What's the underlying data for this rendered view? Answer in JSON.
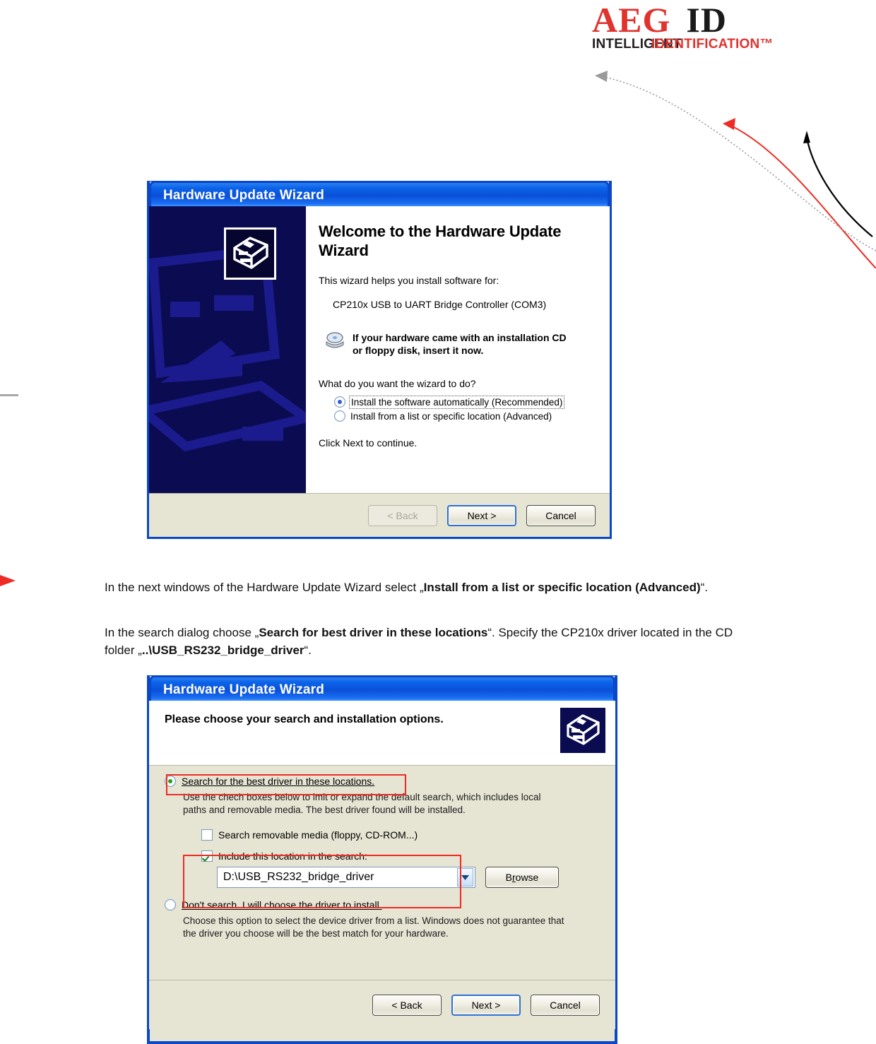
{
  "logo": {
    "primary": "AEG",
    "secondary": "ID",
    "tagline_black": "INTELLIGENT",
    "tagline_red": "IDENTIFICATION™",
    "red": "#e0332e",
    "black": "#1a1a1a"
  },
  "dialog1": {
    "title": "Hardware Update Wizard",
    "heading": "Welcome to the Hardware Update Wizard",
    "intro": "This wizard helps you install software for:",
    "device": "CP210x USB to UART Bridge Controller (COM3)",
    "cd_note_line1": "If your hardware came with an installation CD",
    "cd_note_line2": "or floppy disk, insert it now.",
    "question": "What do you want the wizard to do?",
    "options": [
      {
        "label": "Install the software automatically (Recommended)",
        "selected": true
      },
      {
        "label": "Install from a list or specific location (Advanced)",
        "selected": false
      }
    ],
    "footer_note": "Click Next to continue.",
    "buttons": {
      "back": "< Back",
      "next": "Next >",
      "cancel": "Cancel"
    }
  },
  "body_text": {
    "p1_a": "In the next windows of the Hardware Update Wizard select „",
    "p1_bold": "Install from a list or specific location (Advanced)",
    "p1_b": "“.",
    "p2_a": "In the search dialog choose „",
    "p2_bold1": "Search for best driver in these locations",
    "p2_b": "“. Specify the CP210x driver located in the CD folder „",
    "p2_bold2": "..\\USB_RS232_bridge_driver",
    "p2_c": "“."
  },
  "dialog2": {
    "title": "Hardware Update Wizard",
    "heading": "Please choose your search and installation options.",
    "option_search": {
      "label": "Search for the best driver in these locations.",
      "selected": true,
      "description_line1": "Use the chech boxes below to lmit or expand the default search, which includes local",
      "description_line2": "paths and removable media. The best driver found will be installed."
    },
    "checkbox_removable": {
      "label": "Search removable media (floppy, CD-ROM...)",
      "checked": false
    },
    "checkbox_location": {
      "label": "Include this location in the search:",
      "checked": true
    },
    "location_value": "D:\\USB_RS232_bridge_driver",
    "browse_button": "Browse",
    "option_dontsearch": {
      "label": "Don't search. I will choose the driver to install.",
      "selected": false,
      "description_line1": "Choose this option to select the device driver from a list.  Windows does not guarantee that",
      "description_line2": "the driver you choose will be the best match for your hardware."
    },
    "buttons": {
      "back": "< Back",
      "next": "Next >",
      "cancel": "Cancel"
    },
    "annotation_color": "#ef2b24"
  }
}
